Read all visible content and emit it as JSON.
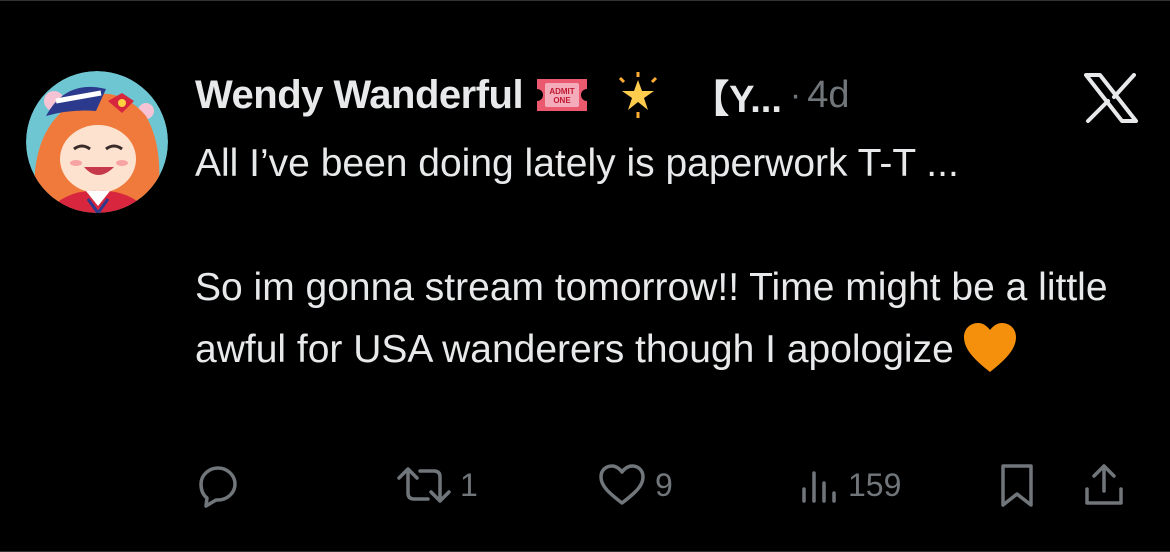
{
  "tweet": {
    "author_name": "Wendy Wanderful",
    "badge_text_top": "ADMIT",
    "badge_text_bottom": "ONE",
    "handle": "【Y...",
    "separator": "·",
    "timestamp": "4d",
    "text_line1": "All I’ve been doing lately is paperwork T-T ...",
    "text_para2": "So im gonna stream tomorrow!! Time might be a little awful for USA wanderers though I apologize"
  },
  "actions": {
    "reply_count": "",
    "retweet_count": "1",
    "like_count": "9",
    "views_count": "159"
  },
  "icons": {
    "reply": "reply-icon",
    "retweet": "retweet-icon",
    "like": "heart-icon",
    "views": "views-icon",
    "bookmark": "bookmark-icon",
    "share": "share-icon",
    "platform": "x-logo-icon"
  },
  "colors": {
    "background": "#000000",
    "primary_text": "#e7e9ea",
    "secondary_text": "#71767b",
    "heart_emoji": "#f4900c",
    "ticket_emoji": "#ea596e"
  }
}
